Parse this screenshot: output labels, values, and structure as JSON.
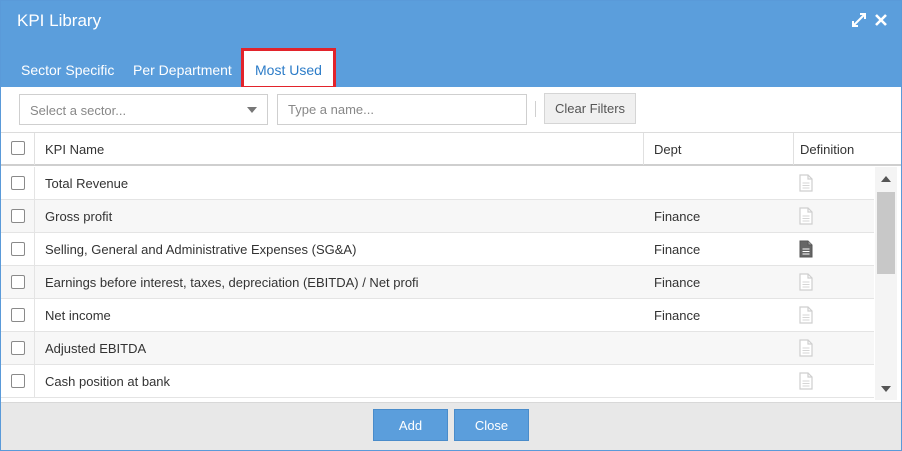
{
  "window": {
    "title": "KPI Library"
  },
  "header_icons": [
    "expand-icon",
    "close-icon"
  ],
  "tabs": [
    {
      "label": "Sector Specific",
      "active": false
    },
    {
      "label": "Per Department",
      "active": false
    },
    {
      "label": "Most Used",
      "active": true
    }
  ],
  "filters": {
    "sector_placeholder": "Select a sector...",
    "name_placeholder": "Type a name...",
    "clear_label": "Clear Filters"
  },
  "table": {
    "columns": [
      "KPI Name",
      "Dept",
      "Definition"
    ],
    "rows": [
      {
        "name": "Total Revenue",
        "dept": "",
        "definition": "empty"
      },
      {
        "name": "Gross profit",
        "dept": "Finance",
        "definition": "empty"
      },
      {
        "name": "Selling, General and Administrative Expenses (SG&A)",
        "dept": "Finance",
        "definition": "filled"
      },
      {
        "name": "Earnings before interest, taxes, depreciation (EBITDA) / Net profi",
        "dept": "Finance",
        "definition": "empty"
      },
      {
        "name": "Net income",
        "dept": "Finance",
        "definition": "empty"
      },
      {
        "name": "Adjusted EBITDA",
        "dept": "",
        "definition": "empty"
      },
      {
        "name": "Cash position at bank",
        "dept": "",
        "definition": "empty"
      }
    ]
  },
  "footer": {
    "add_label": "Add",
    "close_label": "Close"
  },
  "colors": {
    "header": "#5b9edc",
    "active_tab_text": "#2c7cc8",
    "highlight_border": "#e2232b"
  }
}
